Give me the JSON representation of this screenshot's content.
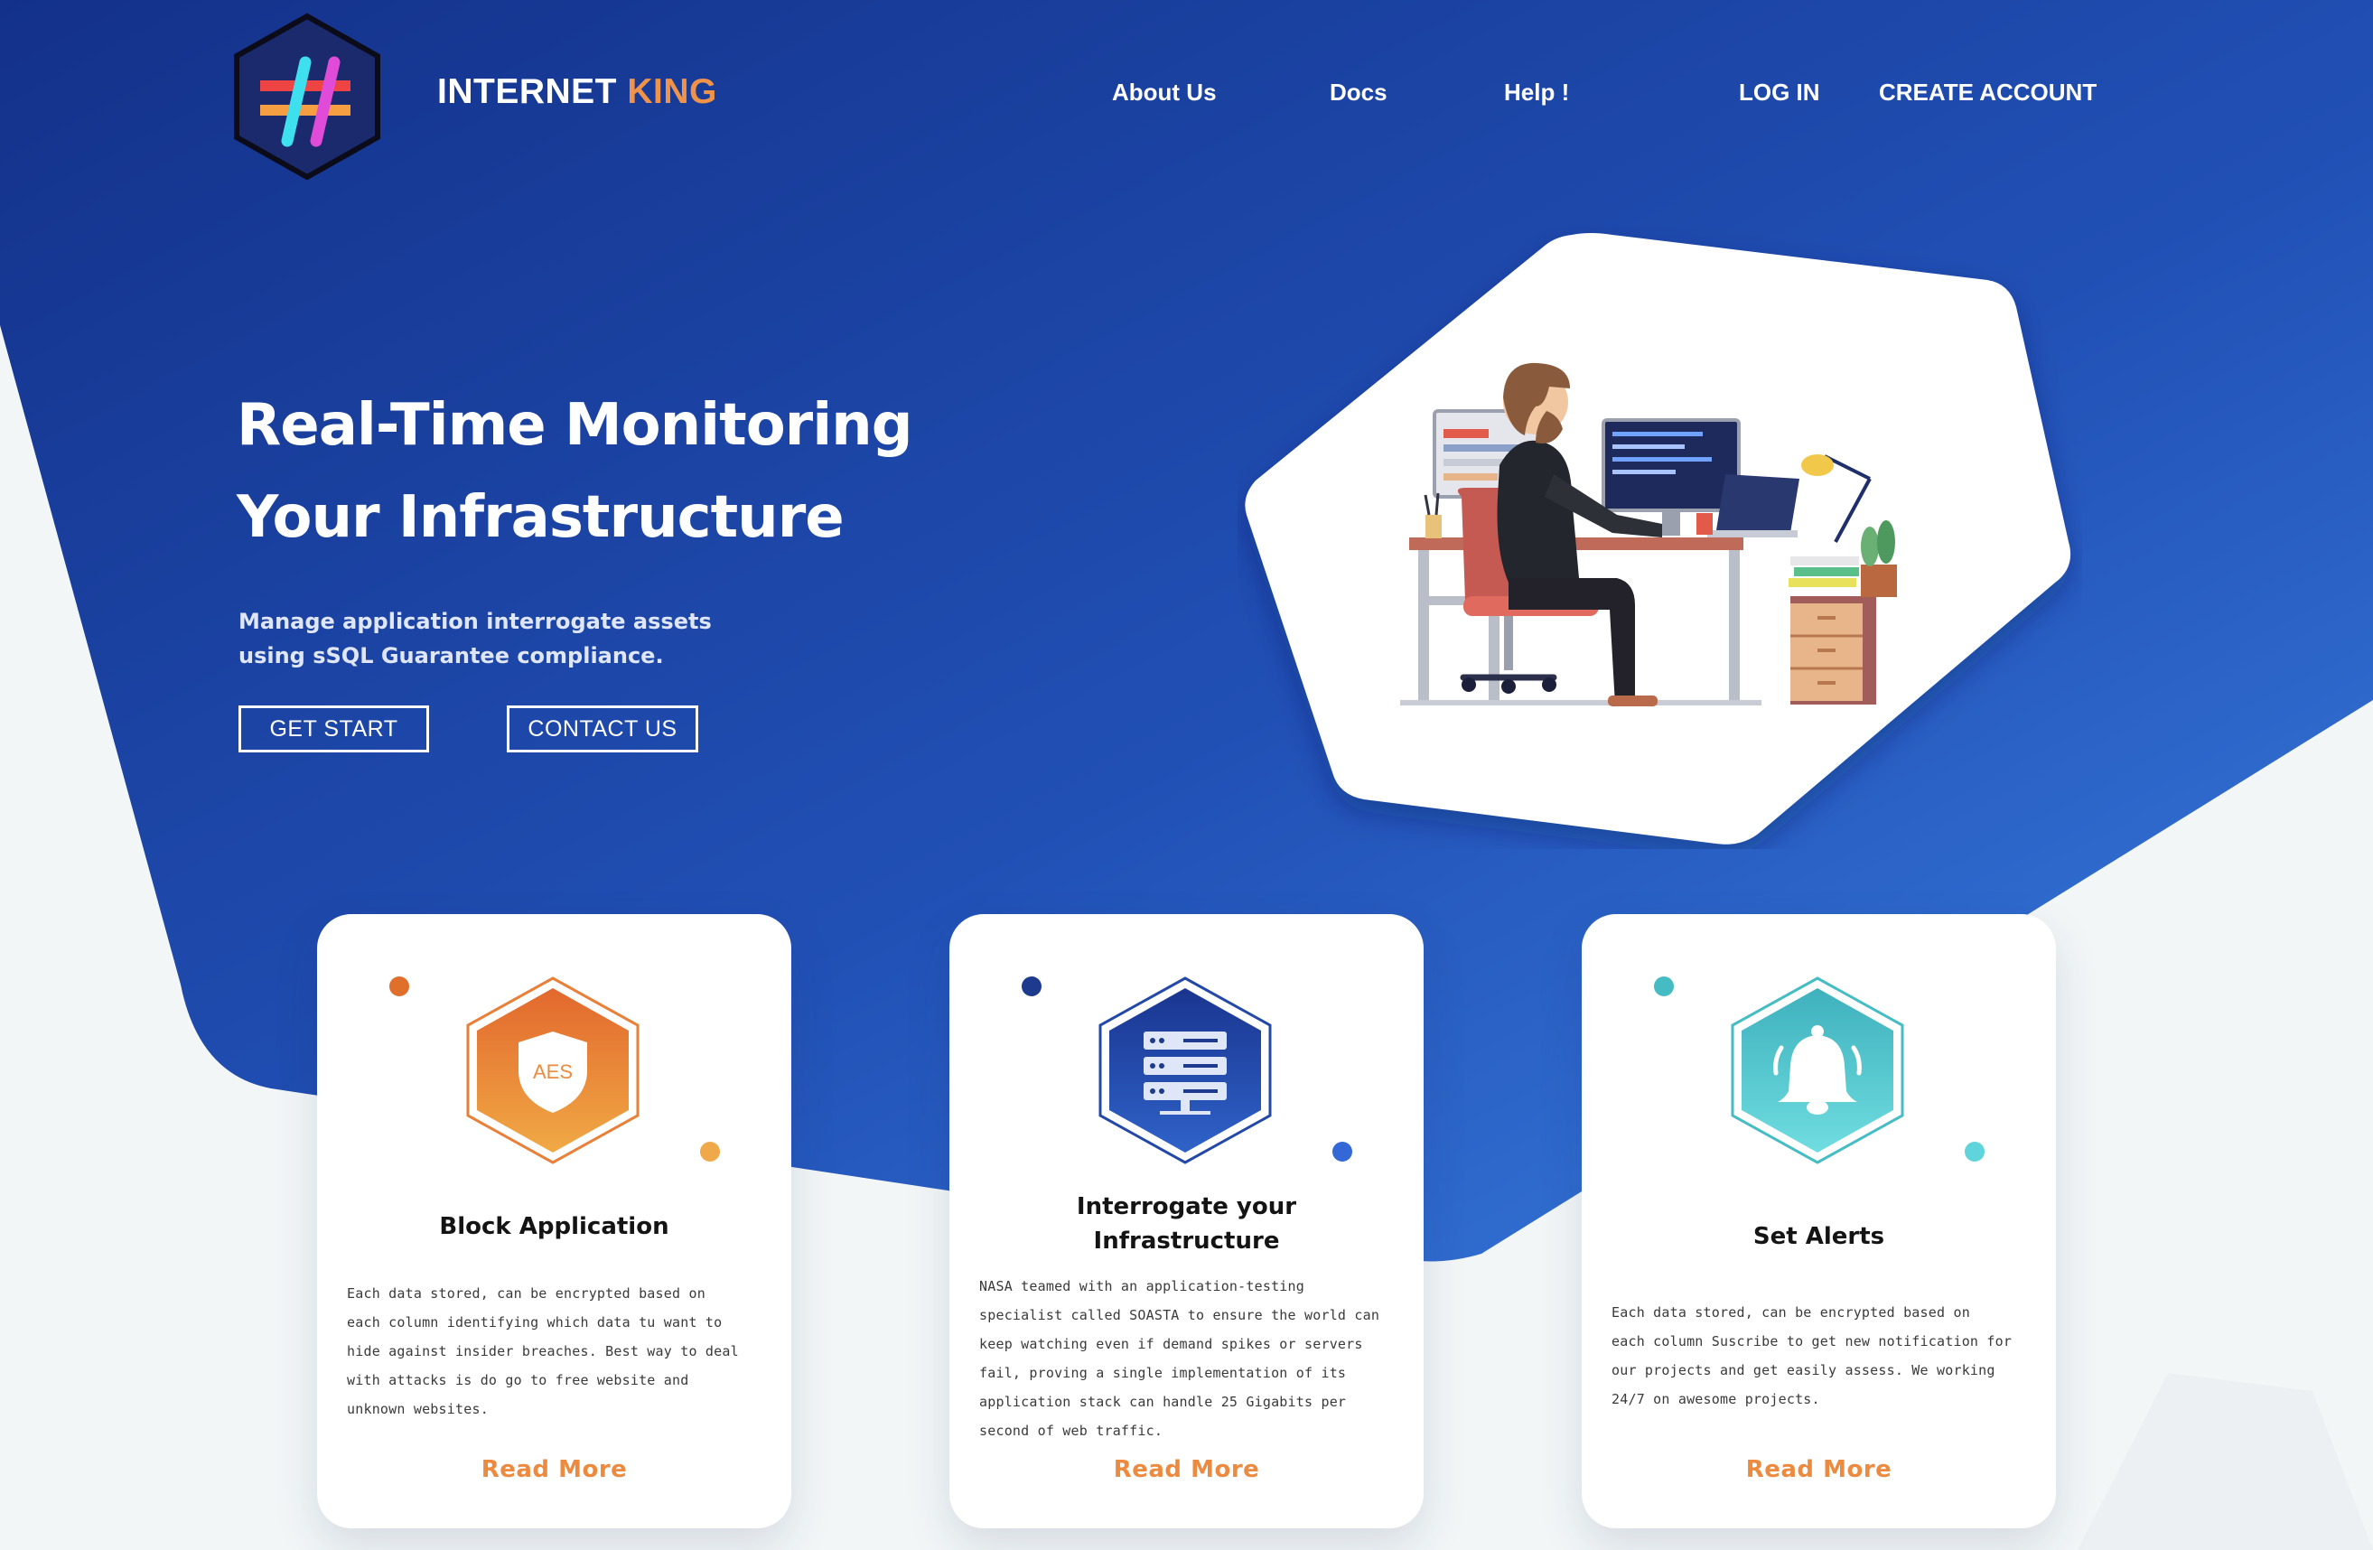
{
  "colors": {
    "hero_dark": "#13318a",
    "hero_light": "#2f6fd0",
    "accent_orange": "#f0934a",
    "card_orange": "#ec8b3f",
    "card_blue": "#1e3fa0",
    "card_teal": "#4cc7cd"
  },
  "brand": {
    "part1": "INTERNET ",
    "part2": "KING",
    "logo_icon": "hashtag-hexagon-logo"
  },
  "nav": {
    "about": "About Us",
    "docs": "Docs",
    "help": "Help !",
    "login": "LOG IN",
    "create_account": "CREATE ACCOUNT"
  },
  "hero": {
    "title_line1": "Real-Time Monitoring",
    "title_line2": "Your Infrastructure",
    "subtitle_line1": "Manage application interrogate assets",
    "subtitle_line2": "using sSQL Guarantee compliance.",
    "btn_start": "GET START",
    "btn_contact": "CONTACT US",
    "illustration": "developer-at-desk-illustration"
  },
  "cards": [
    {
      "icon": "aes-shield-icon",
      "icon_text": "AES",
      "title_lines": [
        "Block Application"
      ],
      "body_lines": [
        "Each data stored, can be encrypted based on",
        "each column identifying which data tu want to",
        "hide against insider breaches. Best way to deal",
        "with attacks is do go to free website and",
        "unknown websites."
      ],
      "more": "Read More"
    },
    {
      "icon": "server-stack-icon",
      "title_lines": [
        "Interrogate your",
        "Infrastructure"
      ],
      "body_lines": [
        "NASA teamed with an application-testing",
        "specialist called SOASTA to ensure the world can",
        "keep watching even if demand spikes or servers",
        "fail, proving a single implementation of its",
        "application stack can handle 25 Gigabits per",
        "second of web traffic."
      ],
      "more": "Read More"
    },
    {
      "icon": "bell-icon",
      "title_lines": [
        "Set Alerts"
      ],
      "body_lines": [
        "Each data stored, can be encrypted based on",
        "each column Suscribe to get new notification for",
        "our projects and get easily assess. We working",
        "24/7 on awesome projects."
      ],
      "more": "Read More"
    }
  ]
}
